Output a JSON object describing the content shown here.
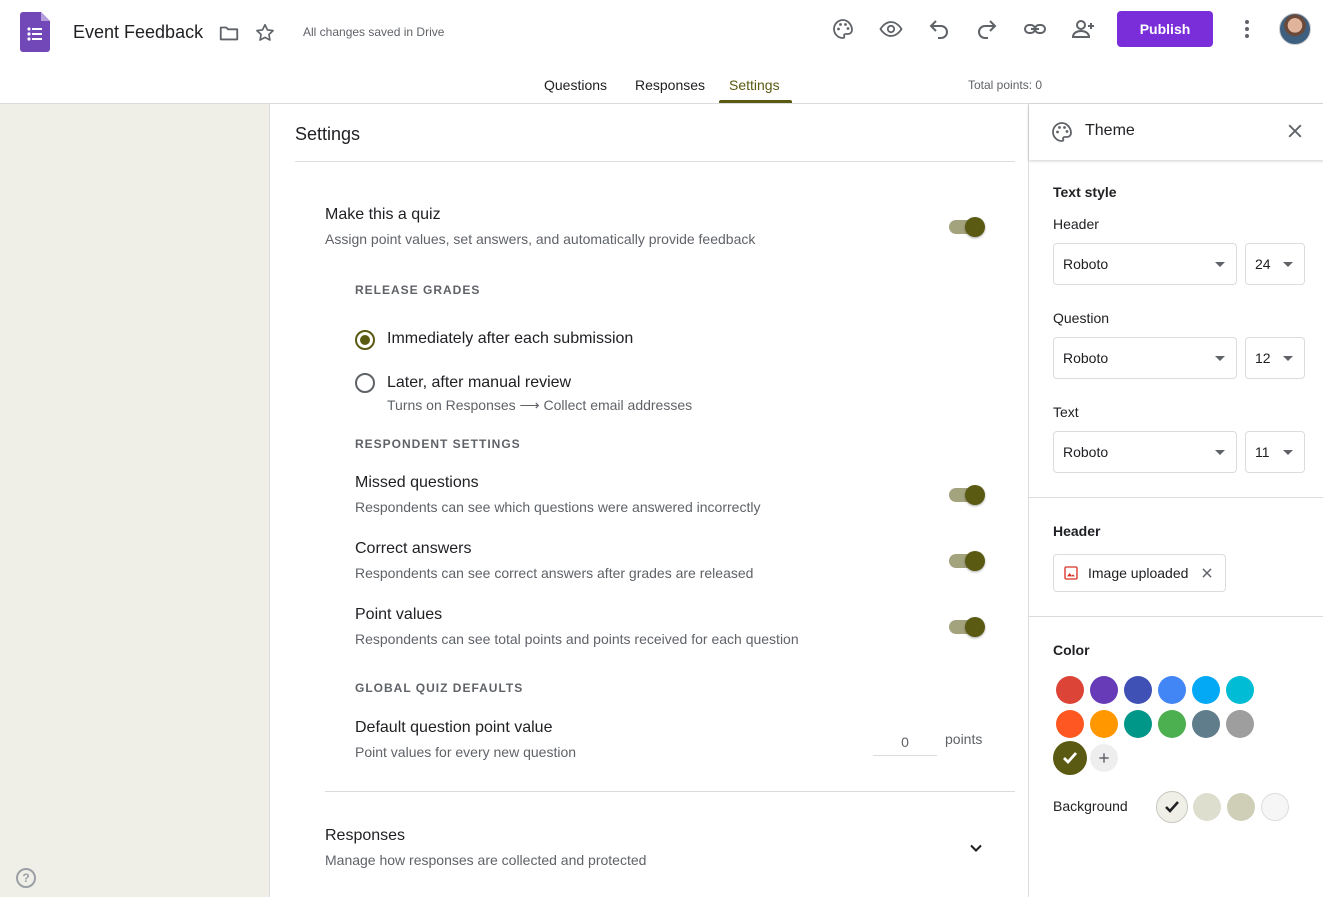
{
  "header": {
    "title": "Event Feedback",
    "save_status": "All changes saved in Drive",
    "publish_label": "Publish",
    "icons": [
      "forms-logo-icon",
      "folder-icon",
      "star-icon",
      "palette-icon",
      "preview-eye-icon",
      "undo-icon",
      "redo-icon",
      "link-icon",
      "add-collaborator-icon",
      "more-vert-icon",
      "avatar"
    ]
  },
  "tabs": [
    {
      "label": "Questions",
      "active": false
    },
    {
      "label": "Responses",
      "active": false
    },
    {
      "label": "Settings",
      "active": true
    }
  ],
  "total_points": "Total points: 0",
  "settings": {
    "title": "Settings",
    "quiz": {
      "title": "Make this a quiz",
      "subtitle": "Assign point values, set answers, and automatically provide feedback",
      "enabled": true
    },
    "release_grades": {
      "label": "RELEASE GRADES",
      "options": [
        {
          "label": "Immediately after each submission",
          "selected": true
        },
        {
          "label": "Later, after manual review",
          "hint": "Turns on Responses ⟶ Collect email addresses",
          "selected": false
        }
      ]
    },
    "respondent_settings": {
      "label": "RESPONDENT SETTINGS",
      "items": [
        {
          "title": "Missed questions",
          "subtitle": "Respondents can see which questions were answered incorrectly",
          "enabled": true
        },
        {
          "title": "Correct answers",
          "subtitle": "Respondents can see correct answers after grades are released",
          "enabled": true
        },
        {
          "title": "Point values",
          "subtitle": "Respondents can see total points and points received for each question",
          "enabled": true
        }
      ]
    },
    "global_defaults": {
      "label": "GLOBAL QUIZ DEFAULTS",
      "title": "Default question point value",
      "subtitle": "Point values for every new question",
      "value": "0",
      "unit": "points"
    },
    "responses": {
      "title": "Responses",
      "subtitle": "Manage how responses are collected and protected"
    }
  },
  "theme": {
    "title": "Theme",
    "text_style_label": "Text style",
    "header": {
      "label": "Header",
      "font": "Roboto",
      "size": "24"
    },
    "question": {
      "label": "Question",
      "font": "Roboto",
      "size": "12"
    },
    "text": {
      "label": "Text",
      "font": "Roboto",
      "size": "11"
    },
    "header_image": {
      "label": "Header",
      "chip": "Image uploaded"
    },
    "color_label": "Color",
    "colors": [
      "#db4437",
      "#673ab7",
      "#3f51b5",
      "#4285f4",
      "#03a9f4",
      "#00bcd4",
      "#ff5722",
      "#ff9800",
      "#009688",
      "#4caf50",
      "#607d8b",
      "#9e9e9e",
      "#5a5a12"
    ],
    "selected_color": "#5a5a12",
    "background_label": "Background",
    "backgrounds": [
      "#efefe8",
      "#dedecf",
      "#cfcfb8",
      "#f6f6f6"
    ],
    "selected_background": "#efefe8"
  },
  "accent_color": "#5a5a12",
  "publish_color": "#7a2ed9"
}
